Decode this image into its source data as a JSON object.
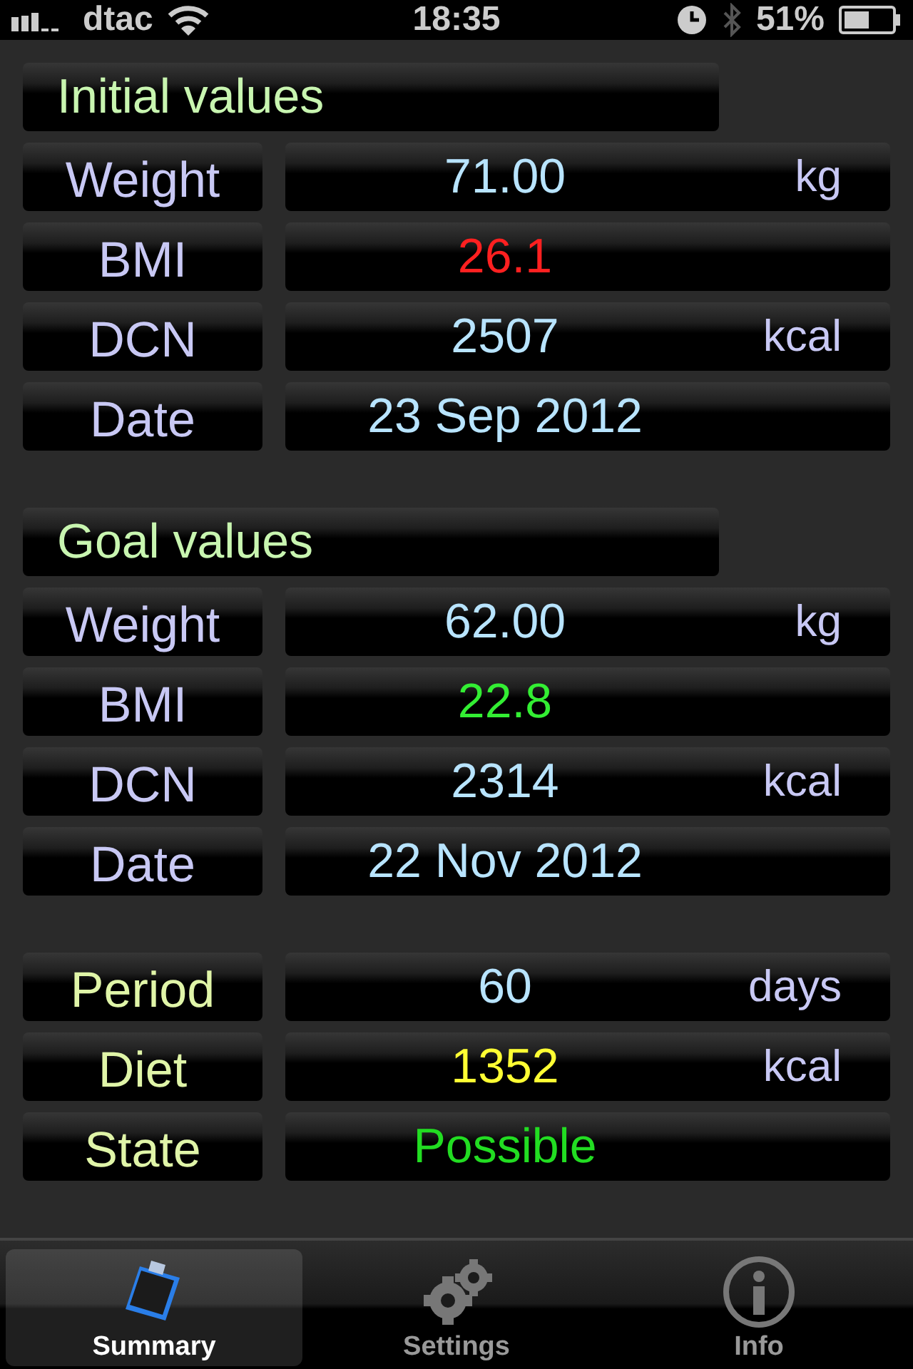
{
  "status_bar": {
    "carrier": "dtac",
    "time": "18:35",
    "battery": "51%"
  },
  "sections": [
    {
      "title": "Initial values",
      "kind": "measure",
      "rows": [
        {
          "label": "Weight",
          "value": "71.00",
          "unit": "kg"
        },
        {
          "label": "BMI",
          "value": "26.1",
          "color": "#ff2020"
        },
        {
          "label": "DCN",
          "value": "2507",
          "unit": "kcal"
        },
        {
          "label": "Date",
          "value": "23 Sep 2012"
        }
      ]
    },
    {
      "title": "Goal values",
      "kind": "measure",
      "rows": [
        {
          "label": "Weight",
          "value": "62.00",
          "unit": "kg"
        },
        {
          "label": "BMI",
          "value": "22.8",
          "color": "#33ee33"
        },
        {
          "label": "DCN",
          "value": "2314",
          "unit": "kcal"
        },
        {
          "label": "Date",
          "value": "22 Nov 2012"
        }
      ]
    },
    {
      "kind": "result",
      "rows": [
        {
          "label": "Period",
          "value": "60",
          "unit": "days"
        },
        {
          "label": "Diet",
          "value": "1352",
          "unit": "kcal",
          "color": "#ffff33"
        },
        {
          "label": "State",
          "value": "Possible",
          "color": "#22dd22"
        }
      ]
    }
  ],
  "tabs": [
    {
      "label": "Summary",
      "kind": "clipboard",
      "selected": true
    },
    {
      "label": "Settings",
      "kind": "gears",
      "selected": false
    },
    {
      "label": "Info",
      "kind": "info",
      "selected": false
    }
  ]
}
